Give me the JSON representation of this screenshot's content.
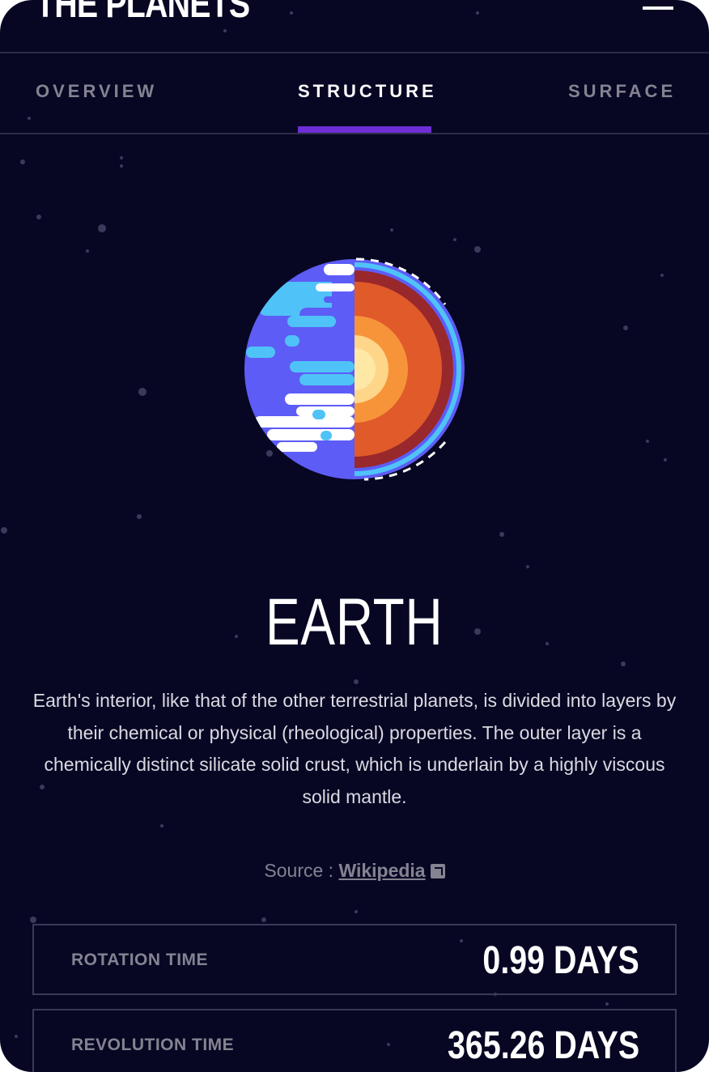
{
  "header": {
    "logo": "THE PLANETS",
    "menu_icon": "hamburger-menu-icon"
  },
  "tabs": [
    {
      "label": "OVERVIEW",
      "active": false
    },
    {
      "label": "STRUCTURE",
      "active": true
    },
    {
      "label": "SURFACE",
      "active": false
    }
  ],
  "accent_color": "#6d2ed5",
  "background_color": "#070724",
  "planet": {
    "image": "earth-internal-structure-illustration",
    "name": "EARTH",
    "description": "Earth's interior, like that of the other terrestrial planets, is divided into layers by their chemical or physical (rheological) properties. The outer layer is a chemically distinct silicate solid crust, which is underlain by a highly viscous solid mantle.",
    "source_prefix": "Source : ",
    "source_link": "Wikipedia",
    "source_icon": "external-link-icon"
  },
  "stats": [
    {
      "label": "ROTATION TIME",
      "value": "0.99 DAYS"
    },
    {
      "label": "REVOLUTION TIME",
      "value": "365.26 DAYS"
    }
  ]
}
